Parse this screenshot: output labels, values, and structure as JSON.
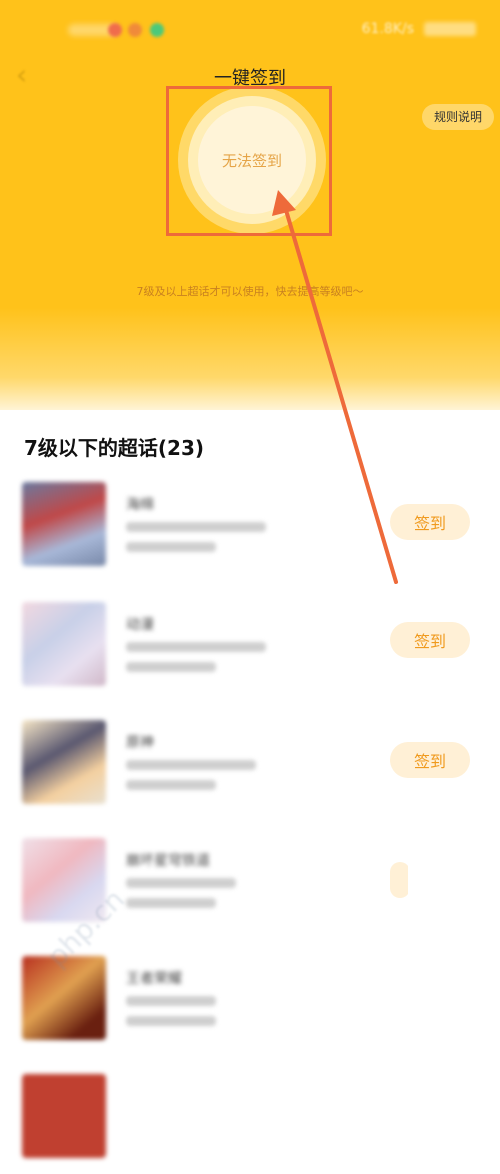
{
  "status_bar": {
    "speed": "61.8K/s"
  },
  "header": {
    "title": "一键签到",
    "rules": "规则说明"
  },
  "sign": {
    "label": "无法签到",
    "hint": "7级及以上超话才可以使用，快去提高等级吧～"
  },
  "section": {
    "title": "7级以下的超话(23)"
  },
  "list": {
    "items": [
      {
        "name": "海绵",
        "sign": "签到"
      },
      {
        "name": "动漫",
        "sign": "签到"
      },
      {
        "name": "原神",
        "sign": "签到"
      },
      {
        "name": "崩坏星穹铁道",
        "sign": ""
      },
      {
        "name": "王者荣耀",
        "sign": ""
      }
    ]
  },
  "watermark": "php.cn",
  "colors": {
    "accent": "#ffc21a",
    "highlight": "#ee6a3a",
    "button_text": "#f09a1e",
    "button_bg": "#fff0d6"
  }
}
